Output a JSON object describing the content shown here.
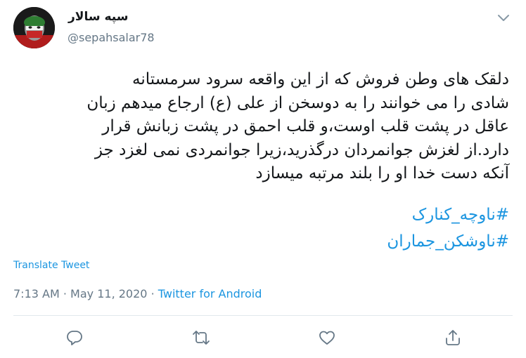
{
  "author": {
    "display_name": "سپه سالار",
    "handle": "@sepahsalar78"
  },
  "tweet": {
    "lines": [
      "دلقک های وطن فروش که از این واقعه سرود سرمستانه",
      "شادی را می خوانند را به دوسخن از علی (ع) ارجاع میدهم زبان",
      "عاقل در پشت قلب اوست،و قلب احمق در پشت زبانش قرار",
      "دارد.از لغزش جوانمردان درگذرید،زیرا جوانمردی نمی لغزد جز",
      "آنکه دست خدا او را بلند مرتبه میسازد"
    ],
    "hashtags": [
      "#ناوچه_کنارک",
      "#ناوشکن_جماران"
    ]
  },
  "translate_label": "Translate Tweet",
  "meta": {
    "time": "7:13 AM",
    "date": "May 11, 2020",
    "separator": "·",
    "source": "Twitter for Android"
  },
  "icons": {
    "caret": "chevron-down-icon",
    "reply": "reply-icon",
    "retweet": "retweet-icon",
    "like": "heart-icon",
    "share": "share-icon"
  },
  "colors": {
    "link": "#1b95e0",
    "muted": "#657786",
    "text": "#14171a",
    "divider": "#e1e8ed"
  }
}
